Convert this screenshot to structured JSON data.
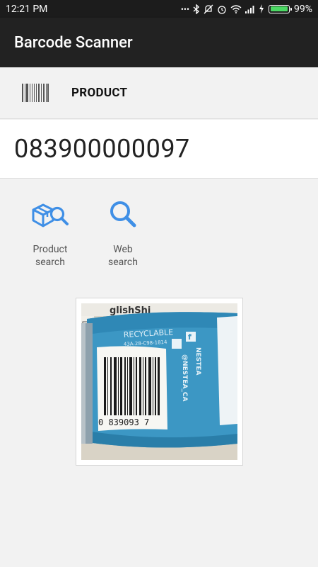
{
  "status_bar": {
    "time": "12:21 PM",
    "battery_percent": "99%",
    "battery_level": 0.99,
    "icons": [
      "dots-icon",
      "bluetooth-icon",
      "mute-icon",
      "alarm-icon",
      "wifi-icon",
      "signal-icon",
      "charging-icon",
      "battery-icon"
    ]
  },
  "app_bar": {
    "title": "Barcode Scanner"
  },
  "result": {
    "type_label": "PRODUCT",
    "code": "083900000097"
  },
  "actions": [
    {
      "label_line1": "Product",
      "label_line2": "search",
      "icon": "product-search-icon"
    },
    {
      "label_line1": "Web",
      "label_line2": "search",
      "icon": "web-search-icon"
    }
  ],
  "scan_image": {
    "printed_text": {
      "recyclable": "RECYCLABLE",
      "recycle_code": "43A-28-C98-1814",
      "brand": "NESTEA",
      "handle": "@NESTEA_CA",
      "barcode_digits": "0  839093  7"
    }
  },
  "colors": {
    "accent_blue": "#3f8fe6",
    "app_bar": "#222222",
    "status_bar": "#1c1c1c",
    "battery_green": "#4cd964"
  }
}
